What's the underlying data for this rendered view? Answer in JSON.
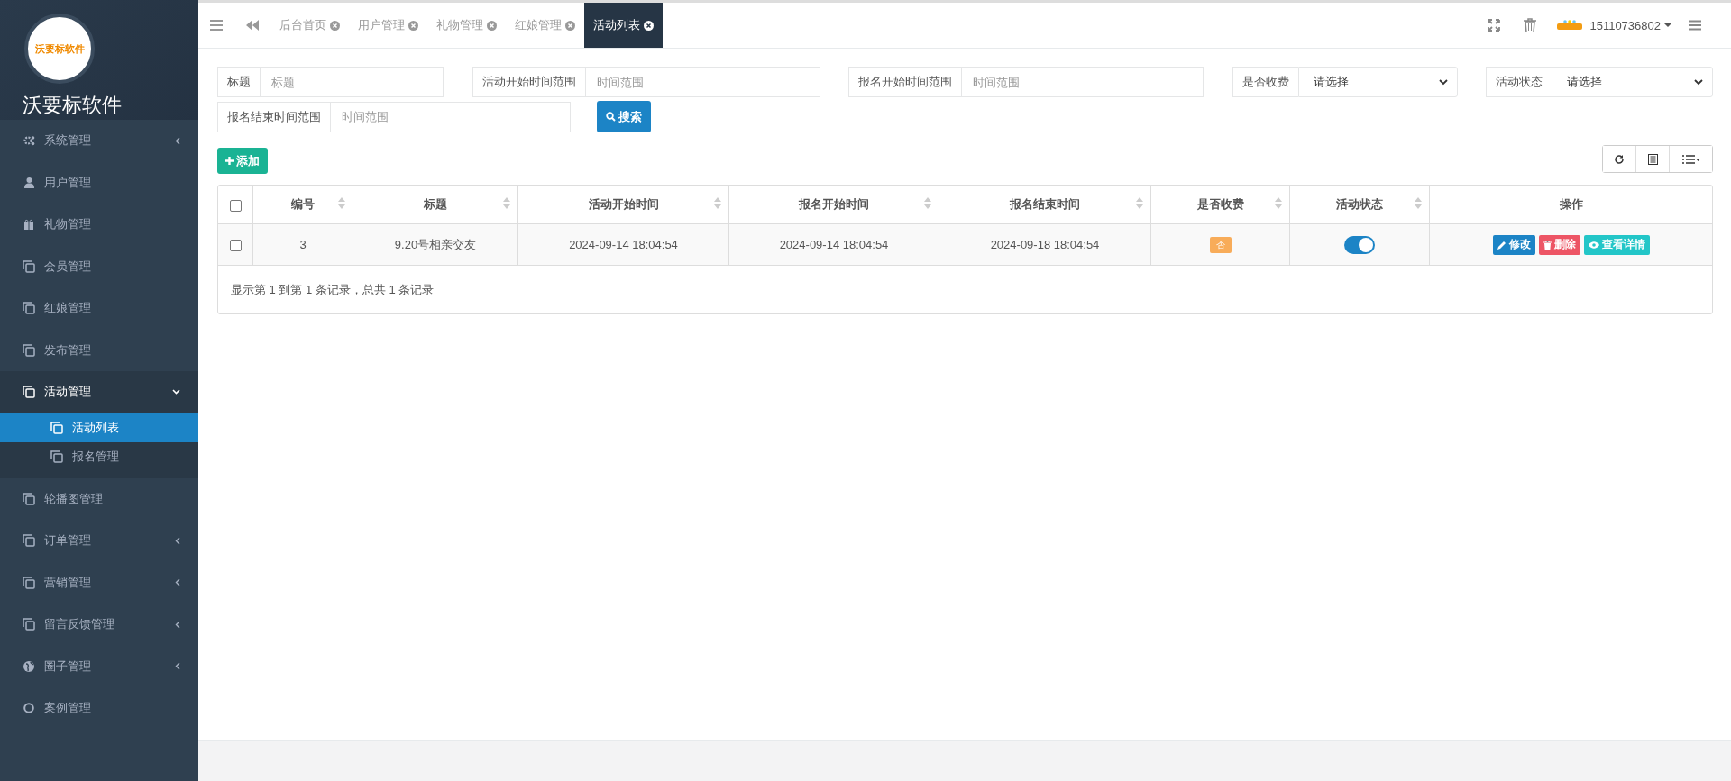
{
  "sidebar": {
    "logo_text": "沃要标软件",
    "brand": "沃要标软件",
    "items": [
      {
        "label": "系统管理",
        "kind": "group",
        "expanded": false,
        "selected": false
      },
      {
        "label": "用户管理",
        "kind": "link",
        "expanded": false,
        "selected": false
      },
      {
        "label": "礼物管理",
        "kind": "link",
        "expanded": false,
        "selected": false
      },
      {
        "label": "会员管理",
        "kind": "link",
        "expanded": false,
        "selected": false
      },
      {
        "label": "红娘管理",
        "kind": "link",
        "expanded": false,
        "selected": false
      },
      {
        "label": "发布管理",
        "kind": "link",
        "expanded": false,
        "selected": false
      },
      {
        "label": "活动管理",
        "kind": "group",
        "expanded": true,
        "selected": false,
        "children": [
          {
            "label": "活动列表",
            "selected": true
          },
          {
            "label": "报名管理",
            "selected": false
          }
        ]
      },
      {
        "label": "轮播图管理",
        "kind": "link",
        "expanded": false,
        "selected": false
      },
      {
        "label": "订单管理",
        "kind": "group",
        "expanded": false,
        "selected": false
      },
      {
        "label": "营销管理",
        "kind": "group",
        "expanded": false,
        "selected": false
      },
      {
        "label": "留言反馈管理",
        "kind": "group",
        "expanded": false,
        "selected": false
      },
      {
        "label": "圈子管理",
        "kind": "group",
        "expanded": false,
        "selected": false
      },
      {
        "label": "案例管理",
        "kind": "link",
        "expanded": false,
        "selected": false
      }
    ]
  },
  "tabs": [
    {
      "label": "后台首页",
      "selected": false
    },
    {
      "label": "用户管理",
      "selected": false
    },
    {
      "label": "礼物管理",
      "selected": false
    },
    {
      "label": "红娘管理",
      "selected": false
    },
    {
      "label": "活动列表",
      "selected": true
    }
  ],
  "user": {
    "name": "15110736802"
  },
  "filters": [
    {
      "kind": "text",
      "label": "标题",
      "placeholder": "标题"
    },
    {
      "kind": "text",
      "label": "活动开始时间范围",
      "placeholder": "时间范围"
    },
    {
      "kind": "text",
      "label": "报名开始时间范围",
      "placeholder": "时间范围"
    },
    {
      "kind": "select",
      "label": "是否收费",
      "value": "请选择"
    },
    {
      "kind": "select",
      "label": "活动状态",
      "value": "请选择"
    },
    {
      "kind": "text",
      "label": "报名结束时间范围",
      "placeholder": "时间范围"
    }
  ],
  "search_button": "搜索",
  "add_button": "添加",
  "table": {
    "select_all": {
      "checked": false
    },
    "columns": [
      "编号",
      "标题",
      "活动开始时间",
      "报名开始时间",
      "报名结束时间",
      "是否收费",
      "活动状态",
      "操作"
    ],
    "rows": [
      {
        "checked": false,
        "id": "3",
        "title": "9.20号相亲交友",
        "activity_start": "2024-09-14 18:04:54",
        "signup_start": "2024-09-14 18:04:54",
        "signup_end": "2024-09-18 18:04:54",
        "paid": "否",
        "active": true,
        "actions": [
          {
            "kind": "edit",
            "label": "修改"
          },
          {
            "kind": "delete",
            "label": "删除"
          },
          {
            "kind": "view",
            "label": "查看详情"
          }
        ]
      }
    ]
  },
  "pagination_info": "显示第 1 到第 1 条记录，总共 1 条记录"
}
